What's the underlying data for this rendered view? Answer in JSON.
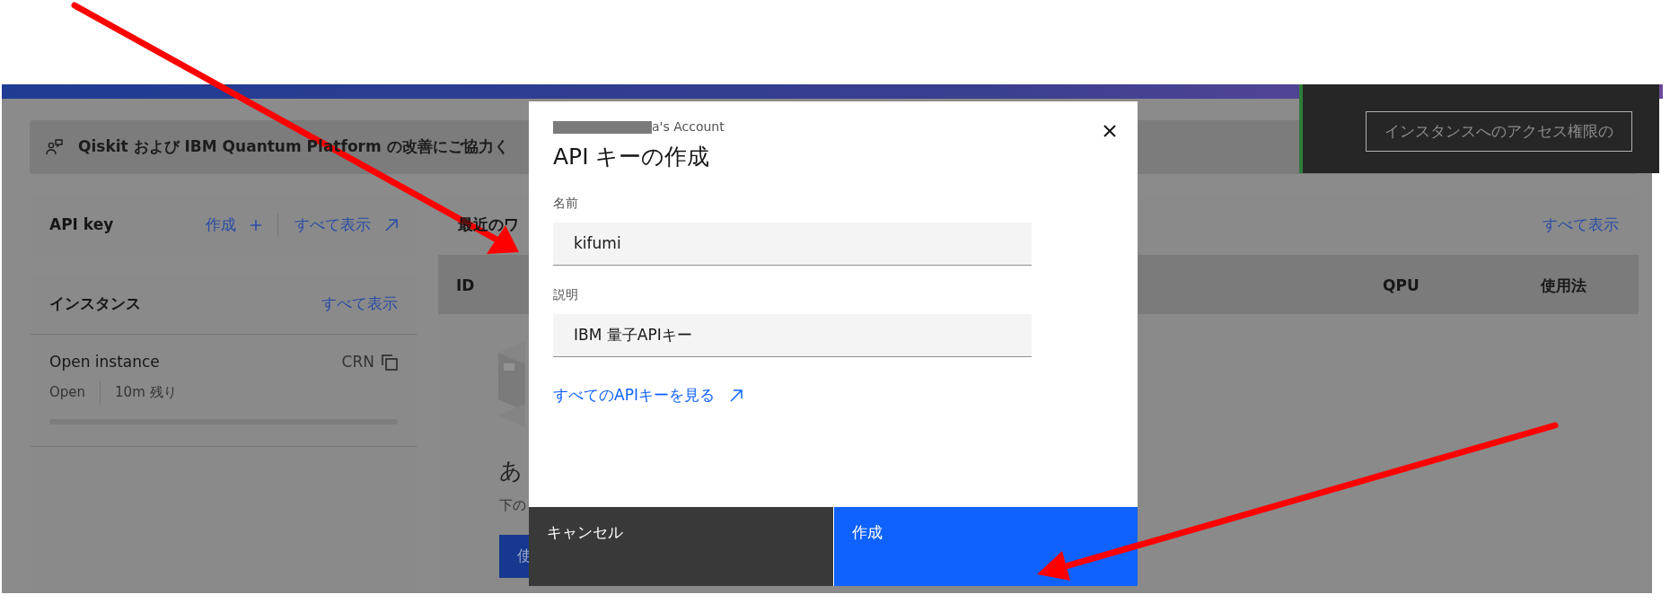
{
  "banner": {
    "text": "Qiskit および IBM Quantum Platform の改善にご協力く"
  },
  "api_key_card": {
    "title": "API key",
    "create_link": "作成",
    "view_all_link": "すべて表示"
  },
  "instances_card": {
    "title": "インスタンス",
    "view_all_link": "すべて表示",
    "instances": [
      {
        "name": "Open instance",
        "crn_label": "CRN",
        "plan": "Open",
        "remaining": "10m 残り"
      }
    ]
  },
  "workloads_card": {
    "title": "最近のワ",
    "view_all_link": "すべて表示",
    "table": {
      "columns": [
        "ID",
        "QPU",
        "使用法"
      ]
    },
    "empty_state": {
      "heading": "あ",
      "text": "下の",
      "button": "使"
    }
  },
  "notification": {
    "button": "インスタンスへのアクセス権限の"
  },
  "modal": {
    "account": "a's Account",
    "title": "API キーの作成",
    "fields": [
      {
        "label": "名前",
        "value": "kifumi"
      },
      {
        "label": "説明",
        "value": "IBM 量子APIキー"
      }
    ],
    "link": "すべてのAPIキーを見る",
    "buttons": [
      {
        "label": "キャンセル",
        "kind": "secondary"
      },
      {
        "label": "作成",
        "kind": "primary"
      }
    ]
  }
}
